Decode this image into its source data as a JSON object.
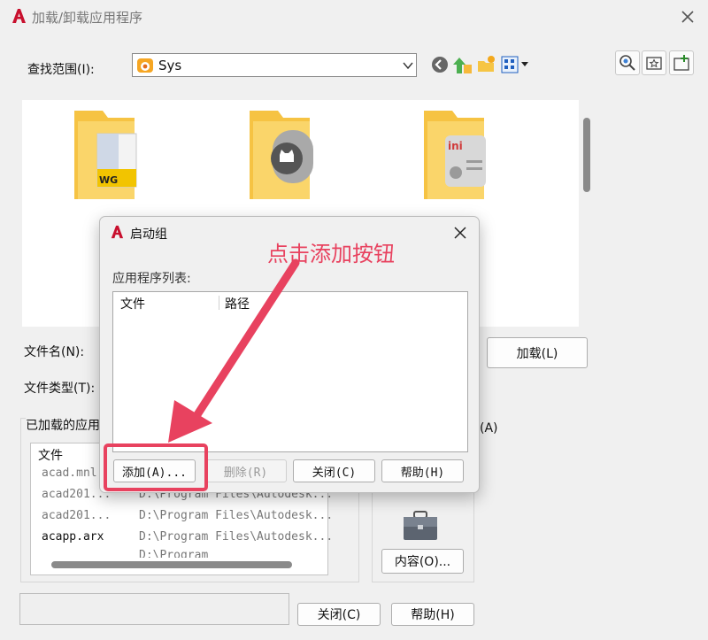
{
  "window": {
    "title": "加载/卸载应用程序",
    "logo_letter": "A"
  },
  "search": {
    "label": "查找范围(I):",
    "value": "Sys"
  },
  "files": {
    "name_label": "文件名(N):",
    "type_label": "文件类型(T):",
    "load_button": "加载(L)"
  },
  "loaded": {
    "group_label": "已加载的应用",
    "header_file": "文件",
    "rows": [
      {
        "file": "acad.mnl",
        "path": ""
      },
      {
        "file": "acad201...",
        "path": "D:\\Program Files\\Autodesk..."
      },
      {
        "file": "acad201...",
        "path": "D:\\Program Files\\Autodesk..."
      },
      {
        "file": "acapp.arx",
        "path": "D:\\Program Files\\Autodesk..."
      },
      {
        "file": "",
        "path": "D:\\Program Files\\Autodesk..."
      }
    ]
  },
  "startup": {
    "partial_label": "(A)",
    "label_partial": "启动组",
    "contents_button": "内容(O)..."
  },
  "bottom": {
    "close_button": "关闭(C)",
    "help_button": "帮助(H)"
  },
  "dialog": {
    "title": "启动组",
    "list_label": "应用程序列表:",
    "col_file": "文件",
    "col_path": "路径",
    "add_button": "添加(A)...",
    "delete_button": "删除(R)",
    "close_button": "关闭(C)",
    "help_button": "帮助(H)"
  },
  "annotation": {
    "text": "点击添加按钮",
    "color": "#e8425f"
  },
  "colors": {
    "accent": "#c8102e",
    "folder": "#f7c948"
  }
}
